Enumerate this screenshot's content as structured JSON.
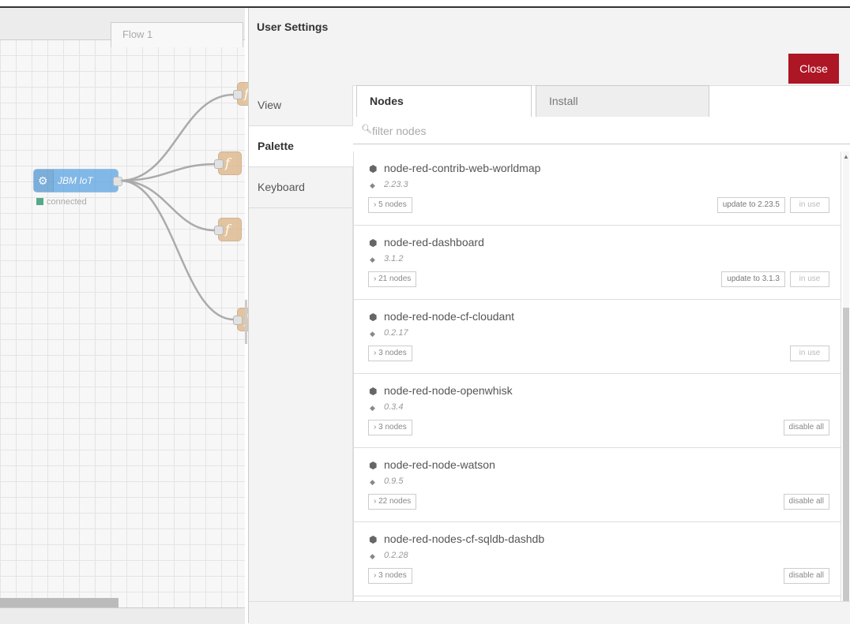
{
  "canvas": {
    "tab_label": "Flow 1",
    "ibm_node_label": "JBM IoT",
    "status_text": "connected",
    "function_glyph": "f"
  },
  "settings": {
    "title": "User Settings",
    "close_label": "Close",
    "nav": [
      {
        "label": "View"
      },
      {
        "label": "Palette"
      },
      {
        "label": "Keyboard"
      }
    ],
    "tabs": [
      {
        "label": "Nodes"
      },
      {
        "label": "Install"
      }
    ],
    "filter_placeholder": "filter nodes",
    "packages": [
      {
        "name": "node-red-contrib-web-worldmap",
        "version": "2.23.3",
        "nodes_label": "› 5 nodes",
        "update_label": "update to 2.23.5",
        "status_label": "in use"
      },
      {
        "name": "node-red-dashboard",
        "version": "3.1.2",
        "nodes_label": "› 21 nodes",
        "update_label": "update to 3.1.3",
        "status_label": "in use"
      },
      {
        "name": "node-red-node-cf-cloudant",
        "version": "0.2.17",
        "nodes_label": "› 3 nodes",
        "status_label": "in use"
      },
      {
        "name": "node-red-node-openwhisk",
        "version": "0.3.4",
        "nodes_label": "› 3 nodes",
        "action_label": "disable all"
      },
      {
        "name": "node-red-node-watson",
        "version": "0.9.5",
        "nodes_label": "› 22 nodes",
        "action_label": "disable all"
      },
      {
        "name": "node-red-nodes-cf-sqldb-dashdb",
        "version": "0.2.28",
        "nodes_label": "› 3 nodes",
        "action_label": "disable all"
      }
    ]
  },
  "colors": {
    "close_button": "#ad1625",
    "ibm_node": "#5aa3e2",
    "function_node": "#ddb88b"
  }
}
